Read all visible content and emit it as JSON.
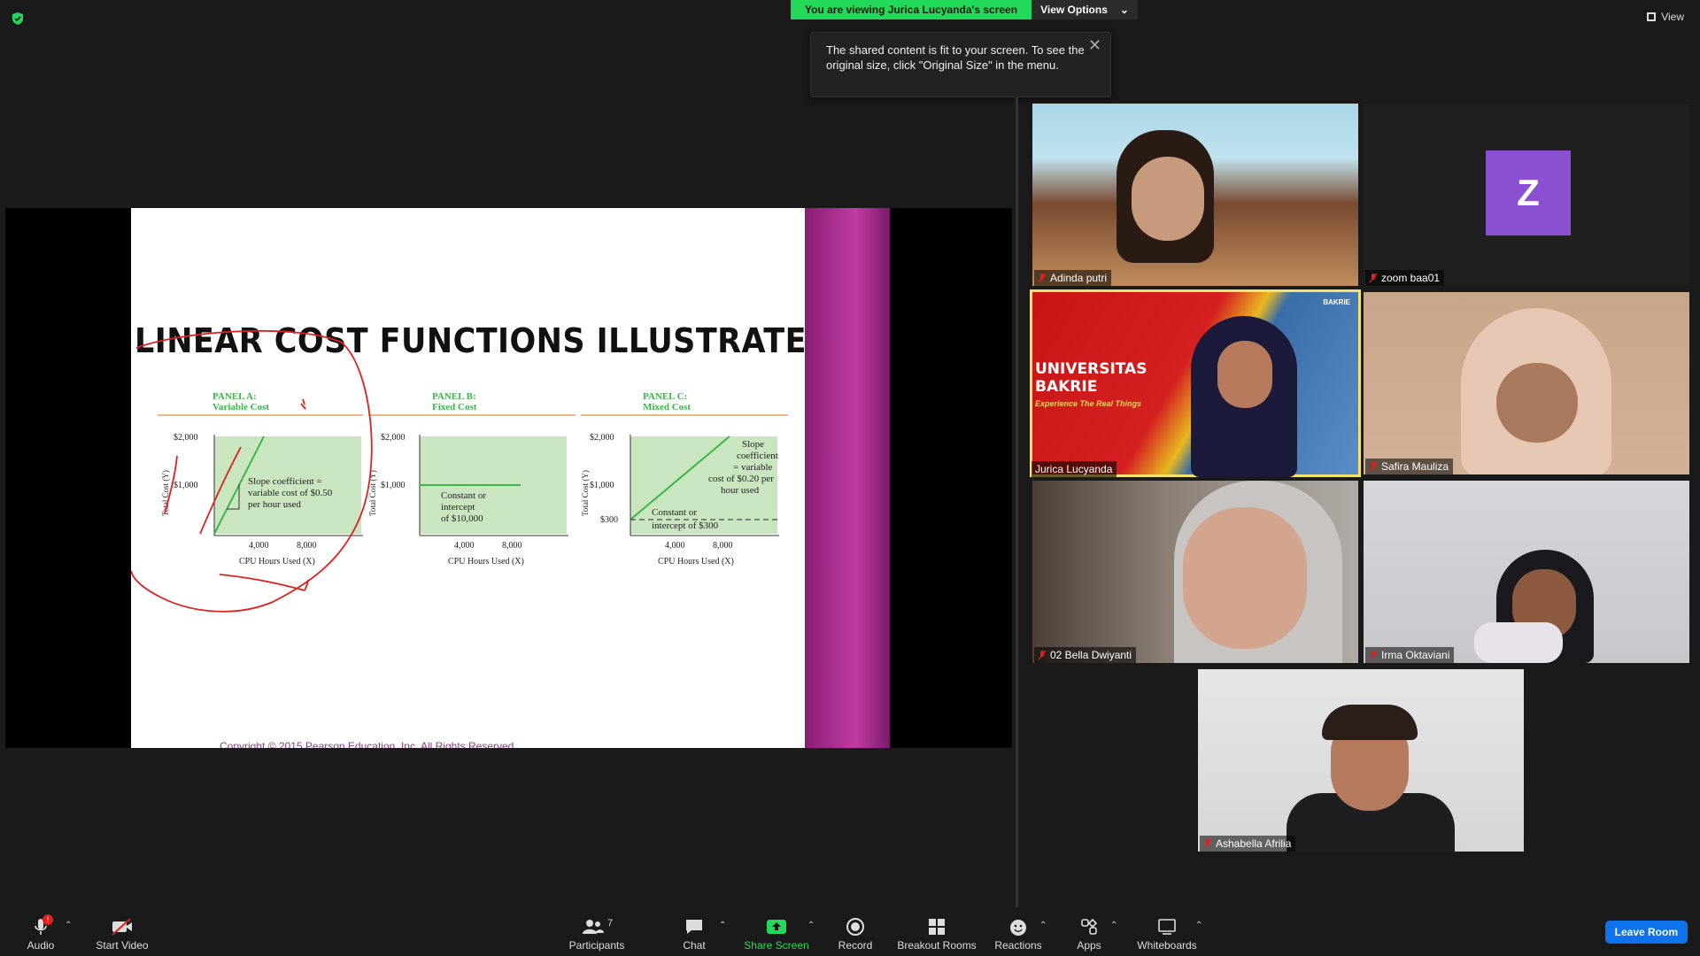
{
  "banner": {
    "viewing": "You are viewing Jurica Lucyanda's screen",
    "view_options": "View Options",
    "view": "View"
  },
  "tooltip": {
    "text": "The shared content is fit to your screen. To see the original size, click \"Original Size\" in the menu."
  },
  "slide": {
    "title": "LINEAR COST FUNCTIONS ILLUSTRATED",
    "copyright": "Copyright © 2015 Pearson Education, Inc. All Rights Reserved",
    "panel_a": {
      "title1": "PANEL A:",
      "title2": "Variable Cost",
      "note1": "Slope coefficient =",
      "note2": "variable cost of $0.50",
      "note3": "per hour used"
    },
    "panel_b": {
      "title1": "PANEL B:",
      "title2": "Fixed Cost",
      "note1": "Constant or",
      "note2": "intercept",
      "note3": "of $10,000"
    },
    "panel_c": {
      "title1": "PANEL C:",
      "title2": "Mixed Cost",
      "note1": "Slope",
      "note2": "coefficient",
      "note3": "= variable",
      "note4": "cost of $0.20 per",
      "note5": "hour used",
      "note6": "Constant or",
      "note7": "intercept of $300"
    },
    "ylabel": "Total Cost (Y)",
    "xlabel": "CPU Hours Used (X)",
    "y2000": "$2,000",
    "y1000": "$1,000",
    "y300": "$300",
    "x4000": "4,000",
    "x8000": "8,000"
  },
  "participants": [
    {
      "name": "Adinda putri"
    },
    {
      "name": "zoom baa01",
      "initial": "Z"
    },
    {
      "name": "Jurica Lucyanda",
      "banner1": "UNIVERSITAS",
      "banner2": "BAKRIE",
      "banner3": "Experience The Real Things",
      "logo": "BAKRIE"
    },
    {
      "name": "Safira Mauliza"
    },
    {
      "name": "02 Bella Dwiyanti"
    },
    {
      "name": "Irma Oktaviani"
    },
    {
      "name": "Ashabella Afrilia"
    }
  ],
  "toolbar": {
    "audio": "Audio",
    "start_video": "Start Video",
    "participants": "Participants",
    "participants_count": "7",
    "chat": "Chat",
    "share_screen": "Share Screen",
    "record": "Record",
    "breakout": "Breakout Rooms",
    "reactions": "Reactions",
    "apps": "Apps",
    "whiteboards": "Whiteboards",
    "leave": "Leave Room",
    "audio_badge": "!"
  },
  "colors": {
    "green": "#23d959",
    "leave_blue": "#0e72ed",
    "active_outline": "#f4e36a",
    "avatar_purple": "#8b4fd1",
    "annotation_red": "#e0201e"
  }
}
